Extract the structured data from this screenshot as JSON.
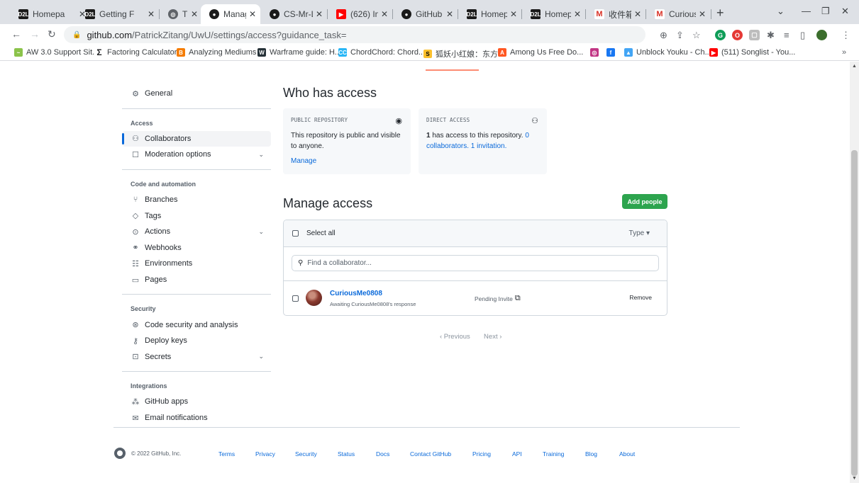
{
  "browser": {
    "tabs": [
      {
        "title": "Homepa",
        "favicon": "D2L"
      },
      {
        "title": "Getting F",
        "favicon": "D2L"
      },
      {
        "title": "The Ultim",
        "favicon": "compass-icon"
      },
      {
        "title": "Manage",
        "favicon": "github-icon"
      },
      {
        "title": "CS-Mr-Le",
        "favicon": "github-icon"
      },
      {
        "title": "(626) In",
        "favicon": "youtube-icon"
      },
      {
        "title": "GitHub C",
        "favicon": "github-icon"
      },
      {
        "title": "Homepa",
        "favicon": "D2L"
      },
      {
        "title": "Homepa",
        "favicon": "D2L"
      },
      {
        "title": "收件箱 (",
        "favicon": "gmail-icon"
      },
      {
        "title": "CuriousM",
        "favicon": "gmail-icon"
      }
    ],
    "url_host": "github.com",
    "url_path": "/PatrickZitang/UwU/settings/access?guidance_task=",
    "bookmarks": [
      "AW 3.0 Support Sit...",
      "Factoring Calculator",
      "Analyzing Mediums",
      "Warframe guide: H...",
      "ChordChord: Chord...",
      "狐妖小红娘：东方...",
      "Among Us Free Do...",
      "",
      "",
      "Unblock Youku - Ch...",
      "(511) Songlist - You..."
    ]
  },
  "sidebar": {
    "general": "General",
    "sections": [
      {
        "heading": "Access",
        "items": [
          "Collaborators",
          "Moderation options"
        ]
      },
      {
        "heading": "Code and automation",
        "items": [
          "Branches",
          "Tags",
          "Actions",
          "Webhooks",
          "Environments",
          "Pages"
        ]
      },
      {
        "heading": "Security",
        "items": [
          "Code security and analysis",
          "Deploy keys",
          "Secrets"
        ]
      },
      {
        "heading": "Integrations",
        "items": [
          "GitHub apps",
          "Email notifications"
        ]
      }
    ]
  },
  "who_has_access": {
    "title": "Who has access",
    "public_card": {
      "label": "PUBLIC REPOSITORY",
      "text": "This repository is public and visible to anyone.",
      "link": "Manage"
    },
    "direct_card": {
      "label": "DIRECT ACCESS",
      "count": "1",
      "text": " has access to this repository. ",
      "link": "0 collaborators. 1 invitation."
    }
  },
  "manage_access": {
    "title": "Manage access",
    "add_button": "Add people",
    "select_all": "Select all",
    "type_filter": "Type ▾",
    "search_placeholder": "Find a collaborator...",
    "collaborator": {
      "name": "CuriousMe0808",
      "status": "Awaiting CuriousMe0808's response",
      "pending": "Pending Invite",
      "remove": "Remove"
    },
    "pager": {
      "previous": "‹  Previous",
      "next": "Next  ›"
    }
  },
  "footer": {
    "copyright": "© 2022 GitHub, Inc.",
    "links": [
      "Terms",
      "Privacy",
      "Security",
      "Status",
      "Docs",
      "Contact GitHub",
      "Pricing",
      "API",
      "Training",
      "Blog",
      "About"
    ]
  },
  "colors": {
    "accent": "#0969da",
    "green": "#2da44e",
    "underline": "#fd8c73"
  }
}
